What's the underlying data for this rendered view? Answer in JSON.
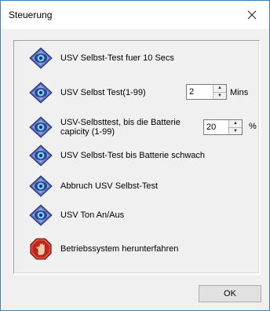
{
  "window": {
    "title": "Steuerung",
    "close_symbol": "×"
  },
  "commands": [
    {
      "label": "USV Selbst-Test fuer 10 Secs",
      "icon": "diamond-eye-icon"
    },
    {
      "label": "USV Selbst Test(1-99)",
      "icon": "diamond-eye-icon"
    },
    {
      "label": "USV-Selbsttest, bis die Batterie capicity (1-99)",
      "icon": "diamond-eye-icon"
    },
    {
      "label": "USV Selbst-Test bis Batterie schwach",
      "icon": "diamond-eye-icon"
    },
    {
      "label": "Abbruch USV Selbst-Test",
      "icon": "diamond-eye-icon"
    },
    {
      "label": "USV Ton An/Aus",
      "icon": "diamond-eye-icon"
    },
    {
      "label": "Betriebssystem herunterfahren",
      "icon": "stop-hand-icon"
    }
  ],
  "minutes_spinner": {
    "value": "2",
    "unit": "Mins"
  },
  "capacity_spinner": {
    "value": "20",
    "unit": "%"
  },
  "buttons": {
    "ok": "OK"
  },
  "colors": {
    "icon_ring": "#3a4fa8",
    "icon_center": "#6fd0e8",
    "stop_red": "#c0241b",
    "window_border": "#3c7fb1"
  }
}
